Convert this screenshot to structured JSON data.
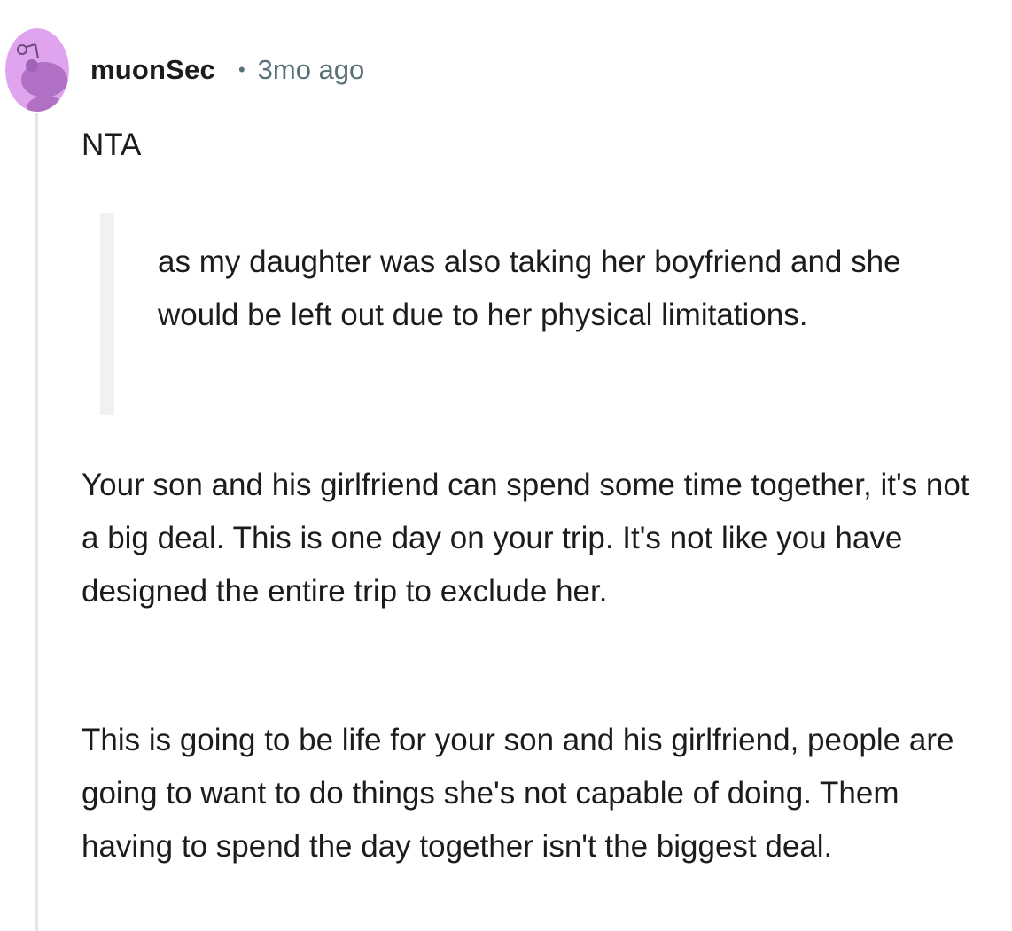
{
  "comment": {
    "author": "muonSec",
    "separator": "•",
    "timestamp": "3mo ago",
    "avatar_icon": "snoo-avatar-icon",
    "avatar_color": "#e0a3ee",
    "verdict": "NTA",
    "quote": "as my daughter was also taking her boyfriend and she would be left out due to her physical limitations.",
    "paragraphs": [
      "Your son and his girlfriend can spend some time together, it's not a big deal. This is one day on your trip. It's not like you have designed the entire trip to exclude her.",
      "This is going to be life for your son and his girlfriend, people are going to want to do things she's not capable of doing. Them having to spend the day together isn't the biggest deal."
    ]
  }
}
